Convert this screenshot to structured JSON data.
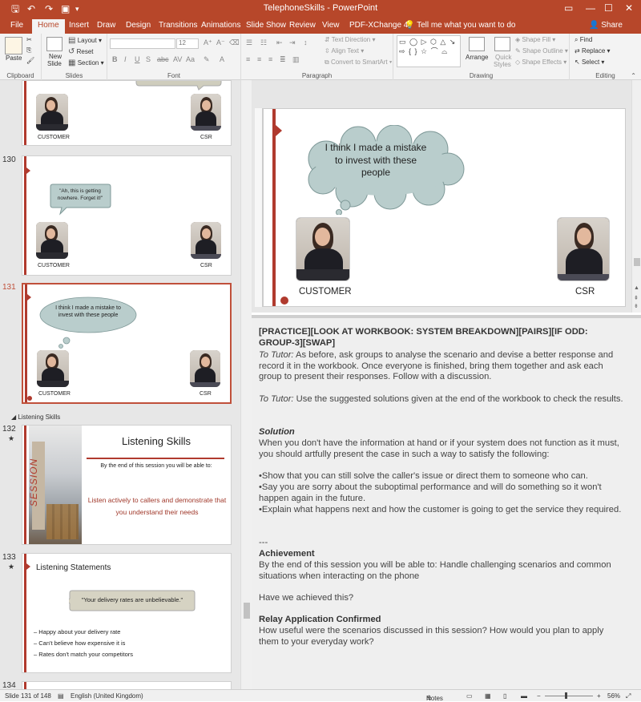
{
  "titlebar": {
    "title": "TelephoneSkills  -  PowerPoint",
    "icons": [
      "save-icon",
      "undo-icon",
      "start-slideshow-icon",
      "customize-icon"
    ]
  },
  "tabs": [
    "File",
    "Home",
    "Insert",
    "Draw",
    "Design",
    "Transitions",
    "Animations",
    "Slide Show",
    "Review",
    "View",
    "PDF-XChange 4"
  ],
  "tell_me": "Tell me what you want to do",
  "share": "Share",
  "ribbon": {
    "clipboard": {
      "paste": "Paste",
      "label": "Clipboard"
    },
    "slides": {
      "new_slide": "New",
      "new_slide2": "Slide",
      "layout": "Layout",
      "reset": "Reset",
      "section": "Section",
      "label": "Slides"
    },
    "font": {
      "size": "12",
      "label": "Font"
    },
    "paragraph": {
      "text_direction": "Text Direction",
      "align_text": "Align Text",
      "smartart": "Convert to SmartArt",
      "label": "Paragraph"
    },
    "drawing": {
      "shapes": "▭ ◯ ▷ ⬡ △ ↘ ⇨ { } ☆ ⌒ ⌓",
      "arrange": "Arrange",
      "quick": "Quick",
      "styles": "Styles",
      "shape_fill": "Shape Fill",
      "shape_outline": "Shape Outline",
      "shape_effects": "Shape Effects",
      "label": "Drawing"
    },
    "editing": {
      "find": "Find",
      "replace": "Replace",
      "select": "Select",
      "label": "Editing"
    }
  },
  "thumbnails": {
    "n130": "130",
    "n131": "131",
    "n132": "132",
    "n133": "133",
    "n134": "134",
    "customer": "CUSTOMER",
    "csr": "CSR",
    "t130_bubble": "\"Ah, this is getting nowhere. Forget it!\"",
    "t131_cloud": "I think I made a mistake to invest with these people",
    "section": "Listening Skills",
    "t132_title": "Listening Skills",
    "t132_sub": "By the end of this session you will be able to:",
    "t132_body": "Listen actively to callers and demonstrate that you understand their needs",
    "t132_side": "SESSION",
    "t133_title": "Listening Statements",
    "t133_quote": "\"Your delivery rates are unbelievable.\"",
    "t133_items": [
      "– Happy about your delivery rate",
      "– Can't believe how expensive it is",
      "– Rates don't match your competitors"
    ]
  },
  "slide": {
    "cloud": "I think I made a mistake to invest with these people",
    "customer": "CUSTOMER",
    "csr": "CSR"
  },
  "notes": {
    "header": "[PRACTICE][LOOK AT WORKBOOK: SYSTEM BREAKDOWN][PAIRS][IF ODD: GROUP-3][SWAP]",
    "tutor_label1": "To Tutor:",
    "tutor1": " As before, ask groups to analyse the scenario and devise a better response and record it in the workbook. Once everyone is finished, bring them together and ask each group to present their responses. Follow with a discussion.",
    "tutor_label2": "To Tutor:",
    "tutor2": " Use the suggested solutions given at the end of the workbook to check the results.",
    "solution_h": "Solution",
    "solution": "When you don't have the information at hand or if your system does not function as it must, you should artfully present the case in such a way to satisfy the following:",
    "bullet1": "•Show that you can still solve the caller's issue or direct them to someone who can.",
    "bullet2": "•Say you are sorry about the suboptimal performance and will do something so it won't happen again in the future.",
    "bullet3": "•Explain what happens next and how the customer is going to get the service they required.",
    "sep": "---",
    "achievement_h": "Achievement",
    "achievement": "By the end of this session you will be able to: Handle challenging scenarios and common situations when interacting on the phone",
    "question": "Have we achieved this?",
    "relay_h": "Relay Application Confirmed",
    "relay": "How useful were the scenarios discussed in this session? How would you plan to apply them to your everyday work?"
  },
  "status": {
    "slide": "Slide 131 of 148",
    "lang": "English (United Kingdom)",
    "notes": "Notes",
    "zoom": "56%"
  },
  "colors": {
    "accent": "#b7472a",
    "slide_red": "#b03a2e",
    "cloud": "#b9cdcc"
  }
}
